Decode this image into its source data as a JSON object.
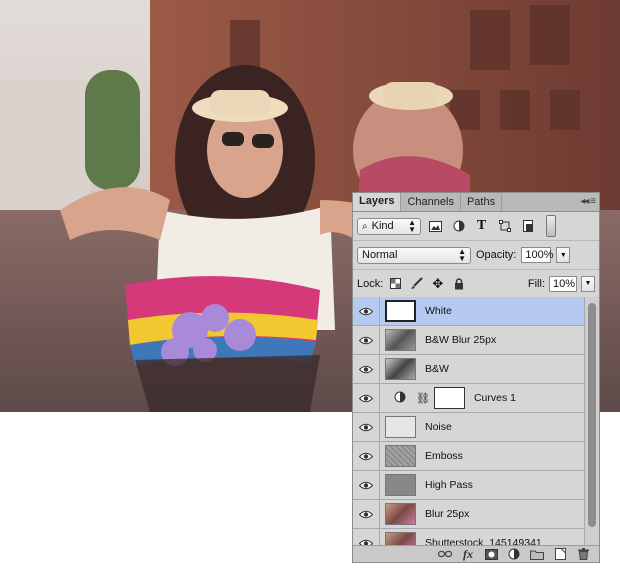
{
  "panel": {
    "tabs": [
      "Layers",
      "Channels",
      "Paths"
    ],
    "menu_icon": "panel-menu-icon"
  },
  "filter": {
    "kind_label": "Kind",
    "icons": [
      "pixel-filter-icon",
      "adjustment-filter-icon",
      "type-filter-icon",
      "shape-filter-icon",
      "smart-object-filter-icon"
    ]
  },
  "blending": {
    "mode": "Normal",
    "opacity_label": "Opacity:",
    "opacity_value": "100%"
  },
  "lock": {
    "label": "Lock:",
    "fill_label": "Fill:",
    "fill_value": "10%"
  },
  "layers": [
    {
      "name": "White",
      "selected": true,
      "thumb": "white"
    },
    {
      "name": "B&W Blur 25px",
      "selected": false,
      "thumb": "photo-gray"
    },
    {
      "name": "B&W",
      "selected": false,
      "thumb": "photo-gray"
    },
    {
      "name": "Curves 1",
      "selected": false,
      "thumb": "curves"
    },
    {
      "name": "Noise",
      "selected": false,
      "thumb": "light"
    },
    {
      "name": "Emboss",
      "selected": false,
      "thumb": "emboss"
    },
    {
      "name": "High Pass",
      "selected": false,
      "thumb": "gray"
    },
    {
      "name": "Blur 25px",
      "selected": false,
      "thumb": "photo-color"
    },
    {
      "name": "Shutterstock_145149341",
      "selected": false,
      "thumb": "photo-color"
    }
  ],
  "bottom_icons": [
    "link-layers-icon",
    "fx-icon",
    "mask-icon",
    "adjustment-layer-icon",
    "group-folder-icon",
    "new-layer-icon",
    "trash-icon"
  ],
  "colors": {
    "selection": "#b6c9f1",
    "panel_bg": "#d6d6d6"
  }
}
